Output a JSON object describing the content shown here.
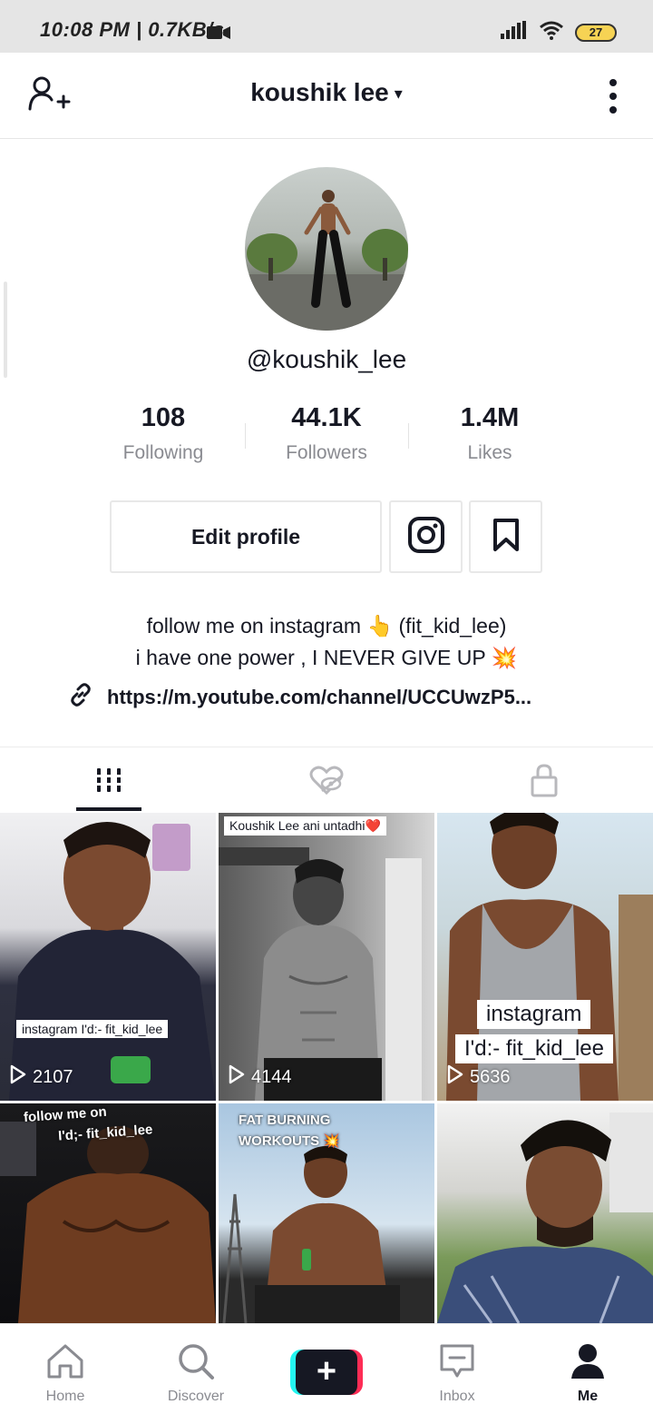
{
  "status_bar": {
    "time": "10:08 PM | 0.7KB/s",
    "battery": "27"
  },
  "header": {
    "title": "koushik lee",
    "caret": "▾"
  },
  "profile": {
    "handle": "@koushik_lee",
    "stats": [
      {
        "value": "108",
        "label": "Following"
      },
      {
        "value": "44.1K",
        "label": "Followers"
      },
      {
        "value": "1.4M",
        "label": "Likes"
      }
    ],
    "edit_profile_label": "Edit profile",
    "bio_line1": "follow me on instagram 👆 (fit_kid_lee)",
    "bio_line2": "i have one  power , I NEVER GIVE UP 💥",
    "link": "https://m.youtube.com/channel/UCCUwzP5..."
  },
  "videos": [
    {
      "views": "2107",
      "caption": "instagram I'd:- fit_kid_lee"
    },
    {
      "views": "4144",
      "caption": "Koushik Lee ani untadhi❤️"
    },
    {
      "views": "5636",
      "caption_line1": "instagram",
      "caption_line2": "I'd:- fit_kid_lee"
    },
    {
      "caption_line1": "follow me on",
      "caption_line2": "I'd;- fit_kid_lee"
    },
    {
      "caption_line1": "FAT BURNING",
      "caption_line2": "WORKOUTS 💥"
    },
    {}
  ],
  "bottom_nav": {
    "home": "Home",
    "discover": "Discover",
    "inbox": "Inbox",
    "me": "Me",
    "create": "+"
  },
  "colors": {
    "text": "#161823",
    "muted": "#8a8b91",
    "accent_cyan": "#24f6f0",
    "accent_red": "#fe2c55"
  }
}
